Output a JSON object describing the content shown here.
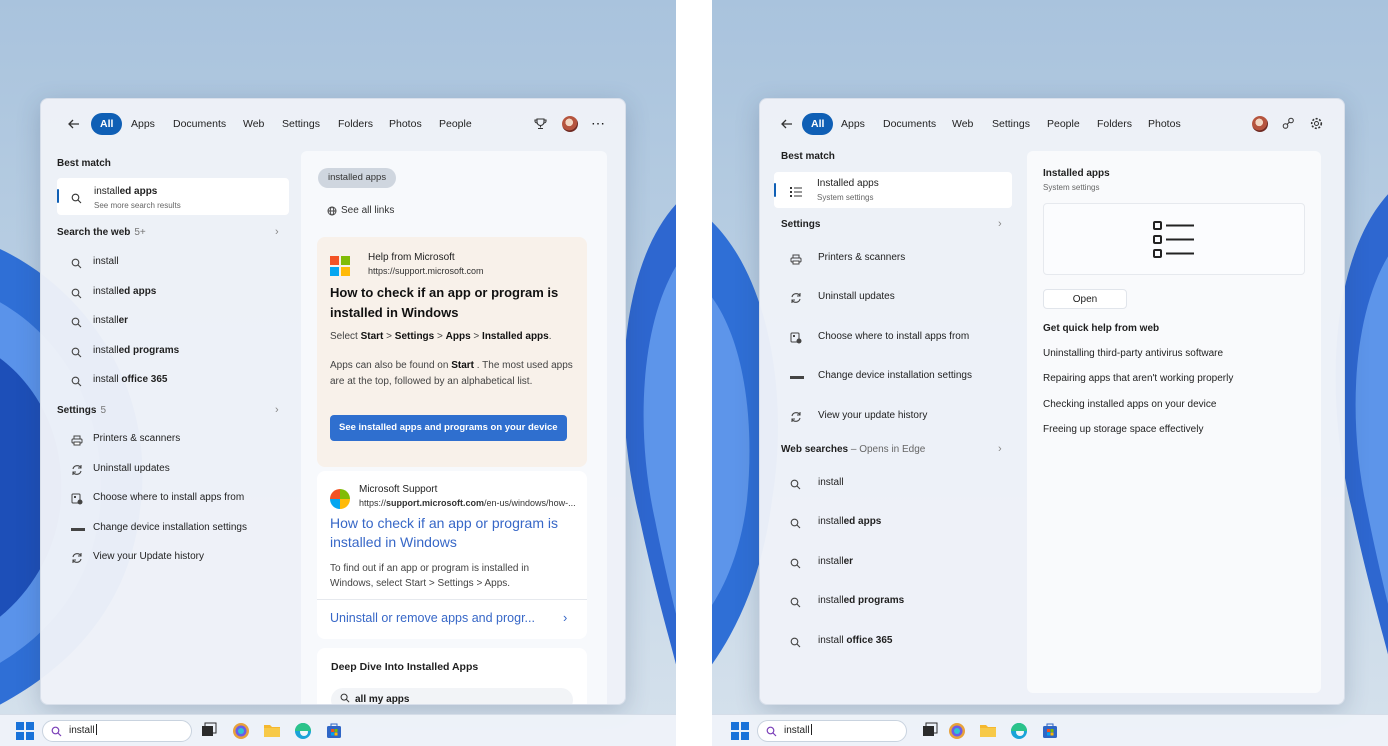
{
  "left": {
    "tabs": [
      "All",
      "Apps",
      "Documents",
      "Web",
      "Settings",
      "Folders",
      "Photos",
      "People"
    ],
    "best_match_heading": "Best match",
    "best_match": {
      "title_plain": "install",
      "title_bold": "ed apps",
      "subtitle": "See more search results"
    },
    "web_heading": "Search the web",
    "web_count": "5+",
    "web_items": [
      {
        "plain": "install",
        "bold": ""
      },
      {
        "plain": "install",
        "bold": "ed apps"
      },
      {
        "plain": "install",
        "bold": "er"
      },
      {
        "plain": "install",
        "bold": "ed programs"
      },
      {
        "plain": "install",
        "bold": " office 365"
      }
    ],
    "settings_heading": "Settings",
    "settings_count": "5",
    "settings_items": [
      "Printers & scanners",
      "Uninstall updates",
      "Choose where to install apps from",
      "Change device installation settings",
      "View your Update history"
    ],
    "preview": {
      "pill": "installed apps",
      "see_all": "See all links",
      "help_source": "Help from Microsoft",
      "help_url": "https://support.microsoft.com",
      "help_title": "How to check if an app or program is installed in Windows",
      "path_prefix": "Select ",
      "path_start": "Start",
      "path_sep": " > ",
      "path_settings": "Settings",
      "path_apps": "Apps",
      "path_installed": "Installed apps",
      "path_end": ".",
      "body_a": "Apps can also be found on ",
      "body_start": "Start",
      "body_b": " . The most used apps are at the top, followed by an alphabetical list.",
      "cta": "See installed apps and programs on your device",
      "support_source": "Microsoft Support",
      "support_url_a": "https://",
      "support_url_b": "support.microsoft.com",
      "support_url_c": "/en-us/windows/how-...",
      "support_title": "How to check if an app or program is installed in Windows",
      "support_body": "To find out if an app or program is installed in Windows, select Start > Settings > Apps.",
      "support_link": "Uninstall or remove apps and progr...",
      "deep_title": "Deep Dive Into Installed Apps",
      "deep_item": "all my apps"
    },
    "taskbar_search": "install"
  },
  "right": {
    "tabs": [
      "All",
      "Apps",
      "Documents",
      "Web",
      "Settings",
      "People",
      "Folders",
      "Photos"
    ],
    "best_match_heading": "Best match",
    "best_match": {
      "title": "Installed apps",
      "subtitle": "System settings"
    },
    "settings_heading": "Settings",
    "settings_items": [
      "Printers & scanners",
      "Uninstall updates",
      "Choose where to install apps from",
      "Change device installation settings",
      "View your update history"
    ],
    "web_heading": "Web searches",
    "web_sub": "– Opens in Edge",
    "web_items": [
      {
        "plain": "install",
        "bold": ""
      },
      {
        "plain": "install",
        "bold": "ed apps"
      },
      {
        "plain": "install",
        "bold": "er"
      },
      {
        "plain": "install",
        "bold": "ed programs"
      },
      {
        "plain": "install",
        "bold": " office 365"
      }
    ],
    "preview": {
      "title": "Installed apps",
      "subtitle": "System settings",
      "open": "Open",
      "quick_heading": "Get quick help from web",
      "quick_items": [
        "Uninstalling third-party antivirus software",
        "Repairing apps that aren't working properly",
        "Checking installed apps on your device",
        "Freeing up storage space effectively"
      ]
    },
    "taskbar_search": "install"
  }
}
